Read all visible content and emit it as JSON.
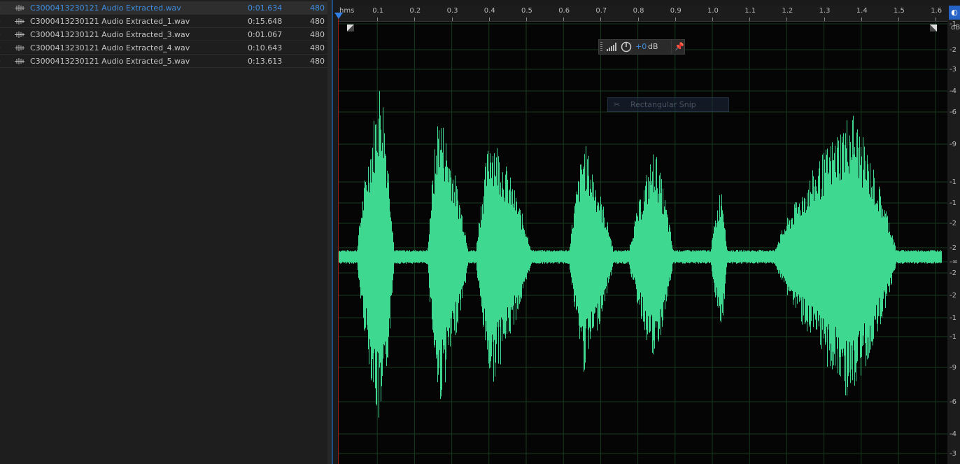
{
  "files": [
    {
      "name": "C3000413230121 Audio Extracted.wav",
      "duration": "0:01.634",
      "rate": "480",
      "selected": true
    },
    {
      "name": "C3000413230121 Audio Extracted_1.wav",
      "duration": "0:15.648",
      "rate": "480",
      "selected": false
    },
    {
      "name": "C3000413230121 Audio Extracted_3.wav",
      "duration": "0:01.067",
      "rate": "480",
      "selected": false
    },
    {
      "name": "C3000413230121 Audio Extracted_4.wav",
      "duration": "0:10.643",
      "rate": "480",
      "selected": false
    },
    {
      "name": "C3000413230121 Audio Extracted_5.wav",
      "duration": "0:13.613",
      "rate": "480",
      "selected": false
    }
  ],
  "ruler": {
    "unit": "hms",
    "labels": [
      "0.1",
      "0.2",
      "0.3",
      "0.4",
      "0.5",
      "0.6",
      "0.7",
      "0.8",
      "0.9",
      "1.0",
      "1.1",
      "1.2",
      "1.3",
      "1.4",
      "1.5",
      "1.6"
    ],
    "time_range": [
      0,
      1.634
    ]
  },
  "db_scale": {
    "unit": "dB",
    "labels": [
      "-1",
      "-2",
      "-3",
      "-4",
      "-6",
      "-9",
      "-1",
      "-1",
      "-2",
      "-2",
      "-∞",
      "-2",
      "-2",
      "-1",
      "-1",
      "-9",
      "-6",
      "-4",
      "-3"
    ]
  },
  "hud": {
    "value": "+0",
    "unit": "dB"
  },
  "snip_tooltip": {
    "label": "Rectangular Snip"
  },
  "colors": {
    "waveform": "#3fd890",
    "selected_text": "#3f8de0",
    "playhead": "#2f7fe6",
    "grid": "#163a1e"
  },
  "icons": {
    "file": "waveform-icon",
    "chevron": "chevron-right-icon",
    "pin": "pin-icon",
    "meter": "level-meter-icon",
    "knob": "power-knob-icon"
  },
  "waveform_envelope": {
    "description_units": "seconds vs fraction of full scale",
    "bursts": [
      {
        "start": 0.05,
        "peak_t": 0.115,
        "end": 0.15,
        "amp": 0.88
      },
      {
        "start": 0.24,
        "peak_t": 0.27,
        "end": 0.35,
        "amp": 0.72
      },
      {
        "start": 0.37,
        "peak_t": 0.41,
        "end": 0.52,
        "amp": 0.62
      },
      {
        "start": 0.62,
        "peak_t": 0.66,
        "end": 0.74,
        "amp": 0.55
      },
      {
        "start": 0.78,
        "peak_t": 0.85,
        "end": 0.9,
        "amp": 0.52
      },
      {
        "start": 1.0,
        "peak_t": 1.03,
        "end": 1.045,
        "amp": 0.35
      },
      {
        "start": 1.17,
        "peak_t": 1.38,
        "end": 1.5,
        "amp": 0.7
      }
    ]
  }
}
